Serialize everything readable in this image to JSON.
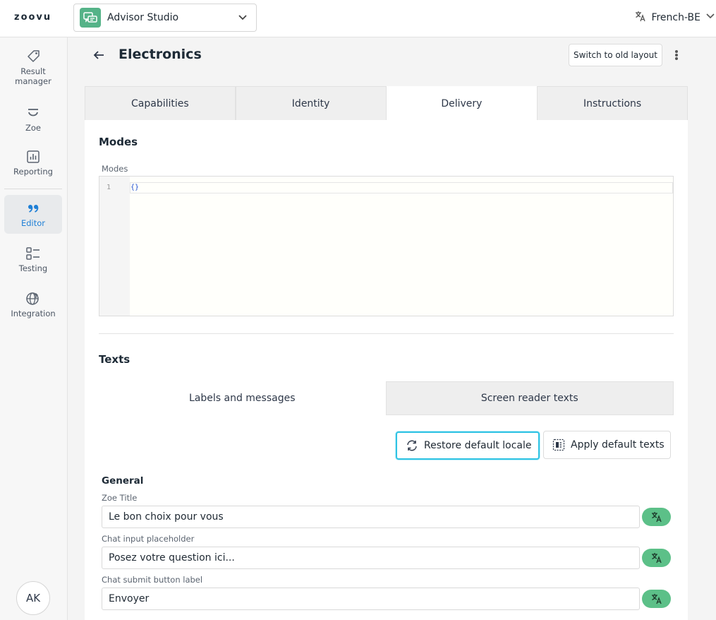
{
  "topbar": {
    "logo": "zoovu",
    "app_name": "Advisor Studio",
    "language": "French-BE"
  },
  "sidebar": {
    "items": [
      {
        "label": "Result manager",
        "icon": "tag-icon"
      },
      {
        "label": "Zoe",
        "icon": "zoe-icon"
      },
      {
        "label": "Reporting",
        "icon": "chart-icon"
      },
      {
        "label": "Editor",
        "icon": "quote-icon"
      },
      {
        "label": "Testing",
        "icon": "testing-icon"
      },
      {
        "label": "Integration",
        "icon": "globe-icon"
      }
    ],
    "active": "Editor",
    "avatar": "AK"
  },
  "header": {
    "title": "Electronics",
    "switch_layout": "Switch to old layout"
  },
  "tabs": [
    {
      "label": "Capabilities"
    },
    {
      "label": "Identity"
    },
    {
      "label": "Delivery"
    },
    {
      "label": "Instructions"
    }
  ],
  "active_tab": "Delivery",
  "modes": {
    "section_title": "Modes",
    "field_label": "Modes",
    "code_line_number": "1",
    "code": "{}"
  },
  "texts": {
    "section_title": "Texts",
    "subtabs": [
      {
        "label": "Labels and messages"
      },
      {
        "label": "Screen reader texts"
      }
    ],
    "restore_button": "Restore default locale",
    "apply_button": "Apply default texts",
    "group_title": "General",
    "fields": [
      {
        "label": "Zoe Title",
        "value": "Le bon choix pour vous"
      },
      {
        "label": "Chat input placeholder",
        "value": "Posez votre question ici..."
      },
      {
        "label": "Chat submit button label",
        "value": "Envoyer"
      }
    ]
  },
  "colors": {
    "accent_blue": "#1e7fd6",
    "brand_green": "#55b388",
    "focus_cyan": "#2fc3e3"
  }
}
